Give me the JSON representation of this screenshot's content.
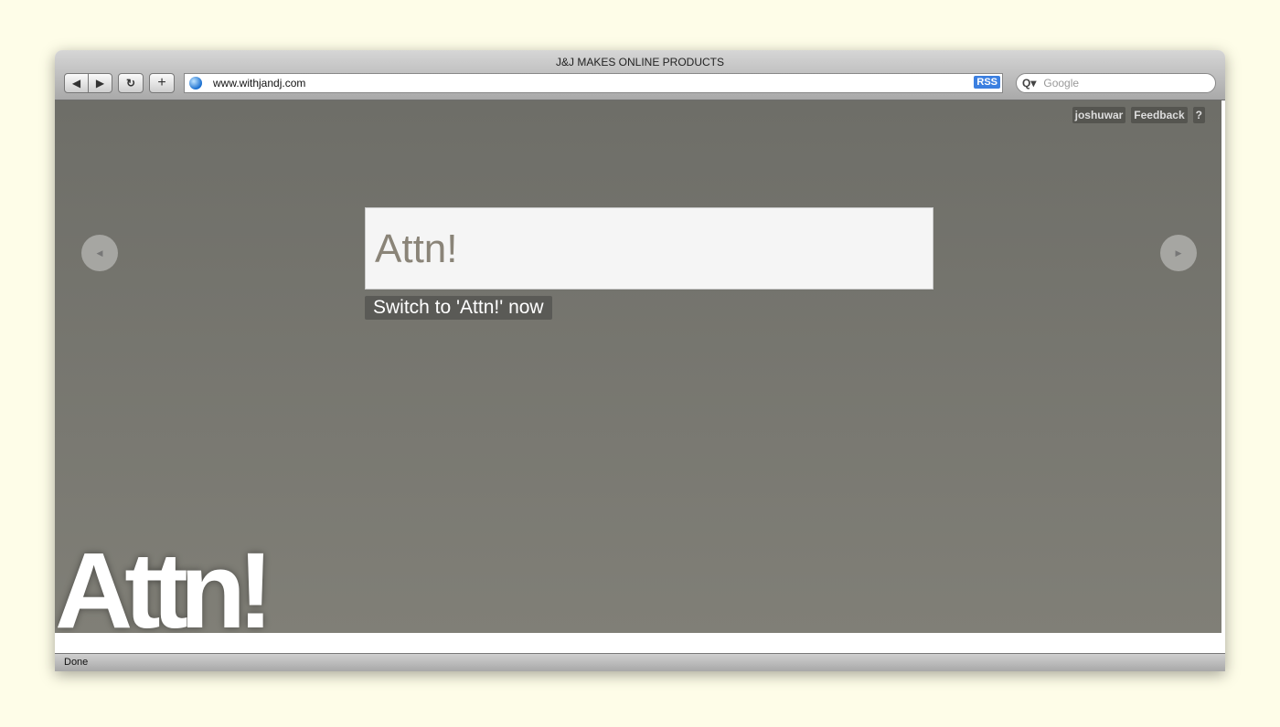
{
  "window": {
    "title": "J&J MAKES ONLINE PRODUCTS"
  },
  "toolbar": {
    "back": "◀",
    "forward": "▶",
    "reload": "↻",
    "add": "+",
    "url": "www.withjandj.com",
    "rss": "RSS",
    "search_placeholder": "Google",
    "search_icon": "Q▾"
  },
  "header": {
    "user": "joshuwar",
    "feedback": "Feedback",
    "help": "?"
  },
  "main": {
    "prev": "◀",
    "next": "▶",
    "product_name": "Attn!",
    "switch_label": "Switch to 'Attn!' now",
    "logo": "Attn!"
  },
  "status": {
    "text": "Done"
  }
}
